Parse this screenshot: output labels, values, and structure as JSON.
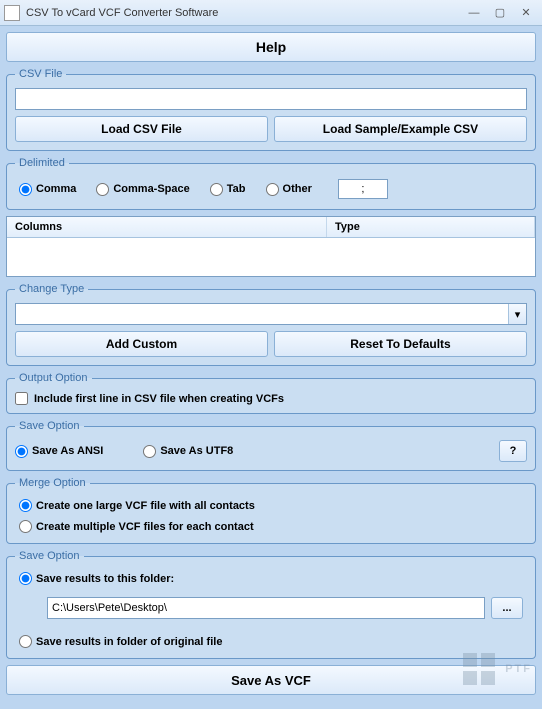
{
  "window": {
    "title": "CSV To vCard VCF Converter Software"
  },
  "help_label": "Help",
  "csv": {
    "legend": "CSV File",
    "value": "",
    "load_btn": "Load CSV File",
    "sample_btn": "Load Sample/Example CSV"
  },
  "delimited": {
    "legend": "Delimited",
    "comma": "Comma",
    "comma_space": "Comma-Space",
    "tab": "Tab",
    "other": "Other",
    "other_value": ";"
  },
  "grid": {
    "col1": "Columns",
    "col2": "Type"
  },
  "change_type": {
    "legend": "Change Type",
    "selected": "",
    "add_custom": "Add Custom",
    "reset": "Reset To Defaults"
  },
  "output_option": {
    "legend": "Output Option",
    "checkbox": "Include first line in CSV file when creating VCFs"
  },
  "save_encoding": {
    "legend": "Save Option",
    "ansi": "Save As ANSI",
    "utf8": "Save As UTF8",
    "help": "?"
  },
  "merge": {
    "legend": "Merge Option",
    "one": "Create one large VCF file with all contacts",
    "multi": "Create multiple VCF files for each contact"
  },
  "save_loc": {
    "legend": "Save Option",
    "folder_radio": "Save results to this folder:",
    "folder_path": "C:\\Users\\Pete\\Desktop\\",
    "browse": "...",
    "original_radio": "Save results in folder of original file"
  },
  "final_btn": "Save As VCF",
  "watermark": "PTF"
}
